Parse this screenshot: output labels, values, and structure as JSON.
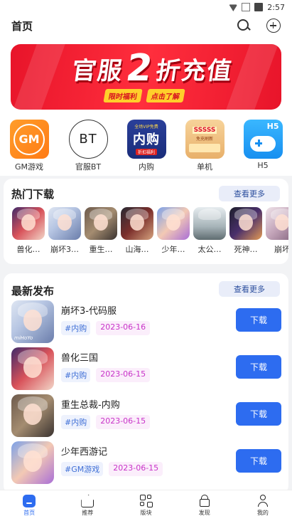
{
  "status_bar": {
    "time": "2:57"
  },
  "header": {
    "title": "首页"
  },
  "banner": {
    "title_left": "官服",
    "title_big": "2",
    "title_right": "折充值",
    "sub_left": "限时福利",
    "sub_right": "点击了解"
  },
  "categories": [
    {
      "label": "GM游戏",
      "icon_text": "GM",
      "icon": "gm-game-icon"
    },
    {
      "label": "官服BT",
      "icon_text": "BT",
      "icon": "bt-icon"
    },
    {
      "label": "内购",
      "icon_text": "内购",
      "icon": "in-app-purchase-icon",
      "icon_sub_top": "全场VIP免费",
      "icon_sub_bottom": "折扣福利"
    },
    {
      "label": "单机",
      "icon_text": "SSSSS",
      "icon": "standalone-game-icon",
      "icon_sub": "免充刷新"
    },
    {
      "label": "H5",
      "icon_text": "H5",
      "icon": "gamepad-icon"
    }
  ],
  "hot": {
    "title": "热门下载",
    "more": "查看更多",
    "items": [
      {
        "name": "兽化…",
        "art": "art-a"
      },
      {
        "name": "崩坏3…",
        "art": "art-b"
      },
      {
        "name": "重生…",
        "art": "art-c"
      },
      {
        "name": "山海…",
        "art": "art-d"
      },
      {
        "name": "少年…",
        "art": "art-e"
      },
      {
        "name": "太公…",
        "art": "art-f"
      },
      {
        "name": "死神…",
        "art": "art-g"
      },
      {
        "name": "崩坏",
        "art": "art-h"
      }
    ]
  },
  "releases": {
    "title": "最新发布",
    "more": "查看更多",
    "download_label": "下载",
    "items": [
      {
        "name": "崩坏3-代码服",
        "tag": "#内购",
        "date": "2023-06-16",
        "art": "art-b",
        "logo": "miHoYo"
      },
      {
        "name": "兽化三国",
        "tag": "#内购",
        "date": "2023-06-15",
        "art": "art-a",
        "logo": ""
      },
      {
        "name": "重生总裁-内购",
        "tag": "#内购",
        "date": "2023-06-15",
        "art": "art-c",
        "logo": ""
      },
      {
        "name": "少年西游记",
        "tag": "#GM游戏",
        "date": "2023-06-15",
        "art": "art-e",
        "logo": ""
      }
    ]
  },
  "nav": [
    {
      "label": "首页",
      "icon": "home-icon",
      "active": true
    },
    {
      "label": "推荐",
      "icon": "thumbs-up-icon",
      "active": false
    },
    {
      "label": "版块",
      "icon": "grid-icon",
      "active": false
    },
    {
      "label": "发现",
      "icon": "gift-icon",
      "active": false
    },
    {
      "label": "我的",
      "icon": "user-icon",
      "active": false
    }
  ]
}
